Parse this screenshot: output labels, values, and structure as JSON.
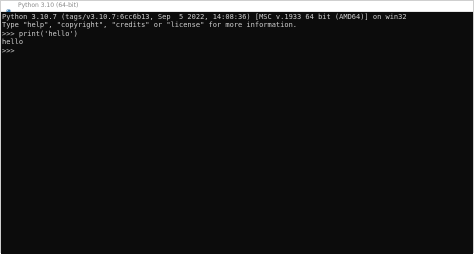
{
  "window": {
    "title": "Python 3.10 (64-bit)"
  },
  "console": {
    "lines": [
      "Python 3.10.7 (tags/v3.10.7:6cc6b13, Sep  5 2022, 14:08:36) [MSC v.1933 64 bit (AMD64)] on win32",
      "Type \"help\", \"copyright\", \"credits\" or \"license\" for more information.",
      ">>> print('hello')",
      "hello",
      ">>>"
    ]
  },
  "colors": {
    "console_background": "#0c0c0c",
    "console_text": "#cccccc",
    "titlebar_background": "#ffffff",
    "title_text": "#8a8a8a"
  },
  "icons": {
    "app": "python-icon"
  }
}
